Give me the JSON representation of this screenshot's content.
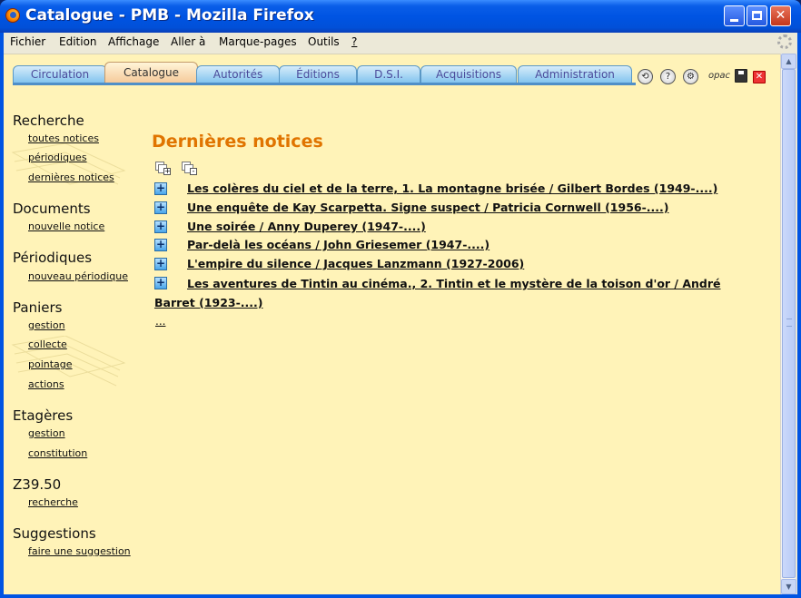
{
  "window": {
    "title": "Catalogue - PMB - Mozilla Firefox",
    "buttons": {
      "minimize": "_",
      "maximize": "□",
      "close": "✕"
    }
  },
  "menubar": {
    "items": [
      {
        "label": "Fichier"
      },
      {
        "label": "Edition"
      },
      {
        "label": "Affichage"
      },
      {
        "label": "Aller à"
      },
      {
        "label": "Marque-pages"
      },
      {
        "label": "Outils"
      },
      {
        "label": "?"
      }
    ]
  },
  "tabs": [
    {
      "label": "Circulation",
      "active": false
    },
    {
      "label": "Catalogue",
      "active": true
    },
    {
      "label": "Autorités",
      "active": false
    },
    {
      "label": "Éditions",
      "active": false
    },
    {
      "label": "D.S.I.",
      "active": false
    },
    {
      "label": "Acquisitions",
      "active": false
    },
    {
      "label": "Administration",
      "active": false
    }
  ],
  "tool_icons": [
    {
      "name": "history-icon",
      "glyph": "⟲"
    },
    {
      "name": "help-icon",
      "glyph": "?"
    },
    {
      "name": "settings-icon",
      "glyph": "⚙"
    },
    {
      "name": "opac-icon",
      "glyph": "opac"
    },
    {
      "name": "save-icon",
      "glyph": ""
    },
    {
      "name": "logout-icon",
      "glyph": "✕"
    }
  ],
  "sidebar": {
    "sections": [
      {
        "title": "Recherche",
        "links": [
          "toutes notices",
          "périodiques",
          "dernières notices"
        ]
      },
      {
        "title": "Documents",
        "links": [
          "nouvelle notice"
        ]
      },
      {
        "title": "Périodiques",
        "links": [
          "nouveau périodique"
        ]
      },
      {
        "title": "Paniers",
        "links": [
          "gestion",
          "collecte",
          "pointage",
          "actions"
        ]
      },
      {
        "title": "Etagères",
        "links": [
          "gestion",
          "constitution"
        ]
      },
      {
        "title": "Z39.50",
        "links": [
          "recherche"
        ]
      },
      {
        "title": "Suggestions",
        "links": [
          "faire une suggestion"
        ]
      }
    ]
  },
  "main": {
    "title": "Dernières notices",
    "notices": [
      "Les colères du ciel et de la terre, 1. La montagne brisée / Gilbert Bordes (1949-....)",
      "Une enquête de Kay Scarpetta. Signe suspect / Patricia Cornwell (1956-....)",
      "Une soirée / Anny Duperey (1947-....)",
      "Par-delà les océans / John Griesemer (1947-....)",
      "L'empire du silence / Jacques Lanzmann (1927-2006)",
      "Les aventures de Tintin au cinéma., 2. Tintin et le mystère de la toison d'or / André Barret (1923-....)"
    ],
    "more": "..."
  },
  "colors": {
    "title_orange": "#e07400",
    "content_bg": "#fff3b8",
    "tab_active": "#f5c898",
    "tab_inactive": "#7fc2ee"
  }
}
